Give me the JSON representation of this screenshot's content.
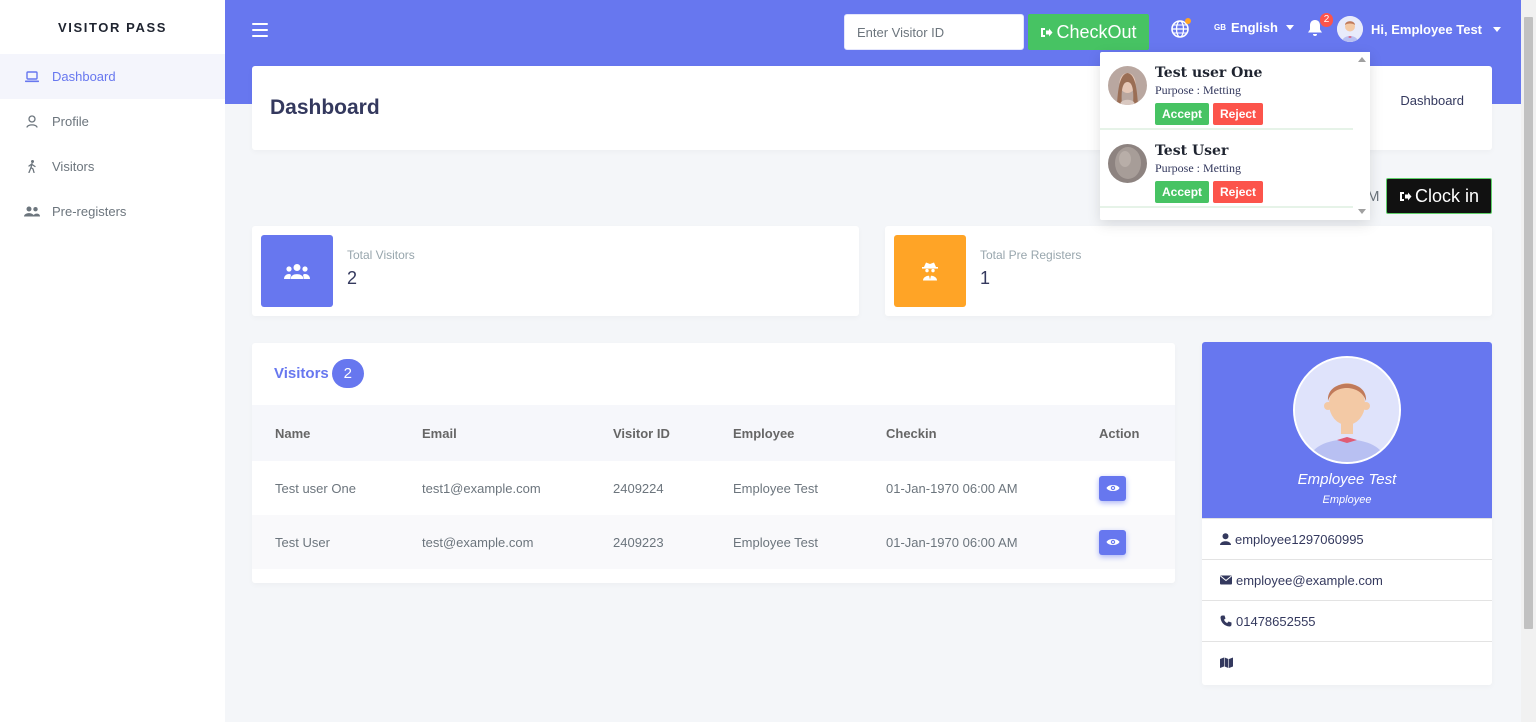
{
  "brand": "VISITOR PASS",
  "sidebar": {
    "items": [
      {
        "label": "Dashboard",
        "icon": "laptop-icon",
        "active": true
      },
      {
        "label": "Profile",
        "icon": "user-icon",
        "active": false
      },
      {
        "label": "Visitors",
        "icon": "walking-icon",
        "active": false
      },
      {
        "label": "Pre-registers",
        "icon": "users-icon",
        "active": false
      }
    ]
  },
  "topbar": {
    "visitor_id_placeholder": "Enter Visitor ID",
    "checkout_label": "CheckOut",
    "language_code": "GB",
    "language_label": "English",
    "notification_count": "2",
    "greeting": "Hi, Employee Test"
  },
  "section": {
    "title": "Dashboard",
    "breadcrumb": "Dashboard"
  },
  "clock_in_label": "Clock in",
  "clock_partial_text": "M",
  "stats": [
    {
      "label": "Total Visitors",
      "value": "2",
      "color": "#6777ef",
      "icon": "users-icon"
    },
    {
      "label": "Total Pre Registers",
      "value": "1",
      "color": "#ffa426",
      "icon": "user-secret-icon"
    }
  ],
  "visitors": {
    "title": "Visitors",
    "count": "2",
    "columns": [
      "Name",
      "Email",
      "Visitor ID",
      "Employee",
      "Checkin",
      "Action"
    ],
    "rows": [
      {
        "name": "Test user One",
        "email": "test1@example.com",
        "visitor_id": "2409224",
        "employee": "Employee Test",
        "checkin": "01-Jan-1970 06:00 AM"
      },
      {
        "name": "Test User",
        "email": "test@example.com",
        "visitor_id": "2409223",
        "employee": "Employee Test",
        "checkin": "01-Jan-1970 06:00 AM"
      }
    ]
  },
  "profile": {
    "name": "Employee Test",
    "role": "Employee",
    "username": "employee1297060995",
    "email": "employee@example.com",
    "phone": "01478652555",
    "address": ""
  },
  "notifications": {
    "items": [
      {
        "name": "Test user One",
        "purpose": "Purpose : Metting",
        "accept_label": "Accept",
        "reject_label": "Reject"
      },
      {
        "name": "Test User",
        "purpose": "Purpose : Metting",
        "accept_label": "Accept",
        "reject_label": "Reject"
      }
    ]
  },
  "colors": {
    "primary": "#6777ef",
    "success": "#47c363",
    "danger": "#fc544b",
    "warning": "#ffa426"
  }
}
